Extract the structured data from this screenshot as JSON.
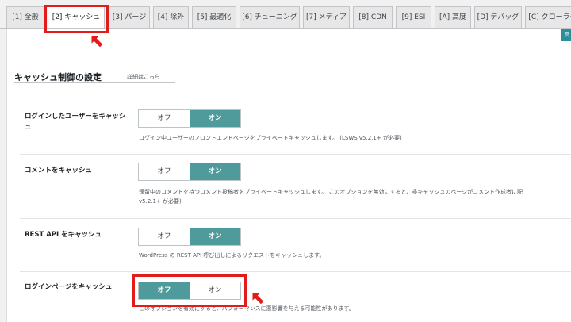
{
  "tabs": [
    {
      "label": "[1] 全般",
      "active": false
    },
    {
      "label": "[2] キャッシュ",
      "active": true
    },
    {
      "label": "[3] パージ",
      "active": false
    },
    {
      "label": "[4] 除外",
      "active": false
    },
    {
      "label": "[5] 最適化",
      "active": false
    },
    {
      "label": "[6] チューニング",
      "active": false
    },
    {
      "label": "[7] メディア",
      "active": false
    },
    {
      "label": "[8] CDN",
      "active": false
    },
    {
      "label": "[9] ESI",
      "active": false
    },
    {
      "label": "[A] 高度",
      "active": false
    },
    {
      "label": "[D] デバッグ",
      "active": false
    },
    {
      "label": "[C] クローラー",
      "active": false
    }
  ],
  "save_tab_label": "高",
  "section": {
    "title": "キャッシュ制御の設定",
    "link": "詳細はこちら"
  },
  "rows": [
    {
      "label": "ログインしたユーザーをキャッシュ",
      "off": "オフ",
      "on": "オン",
      "selected": "on",
      "description": "ログイン中ユーザーのフロントエンドページをプライベートキャッシュします。 (LSWS v5.2.1+ が必要)"
    },
    {
      "label": "コメントをキャッシュ",
      "off": "オフ",
      "on": "オン",
      "selected": "on",
      "description": "保留中のコメントを持つコメント投稿者をプライベートキャッシュします。 このオプションを無効にすると、非キャッシュのページがコメント作成者に配",
      "description2": "v5.2.1+ が必要)"
    },
    {
      "label": "REST API をキャッシュ",
      "off": "オフ",
      "on": "オン",
      "selected": "on",
      "description": "WordPress の REST API 呼び出しによるリクエストをキャッシュします。"
    },
    {
      "label": "ログインページをキャッシュ",
      "off": "オフ",
      "on": "オン",
      "selected": "off",
      "description": "このオプションを有効にすると、パフォーマンスに悪影響を与える可能性があります。"
    }
  ],
  "colors": {
    "accent": "#4f9a9a",
    "highlight": "#e21b1b"
  }
}
